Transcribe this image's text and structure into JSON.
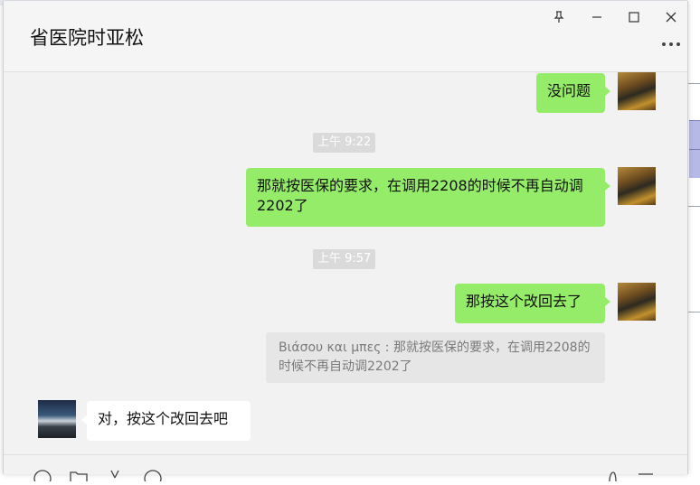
{
  "window": {
    "title": "省医院时亚松",
    "controls": {
      "pin_icon": "pin-icon",
      "minimize_icon": "minimize-icon",
      "maximize_icon": "maximize-icon",
      "close_icon": "close-icon",
      "more_icon": "more-icon"
    }
  },
  "messages": [
    {
      "side": "right",
      "text": "没问题"
    },
    {
      "type": "time",
      "text": "上午 9:22"
    },
    {
      "side": "right",
      "text": "那就按医保的要求，在调用2208的时候不再自动调2202了"
    },
    {
      "type": "time",
      "text": "上午 9:57"
    },
    {
      "side": "right",
      "text": "那按这个改回去了"
    },
    {
      "type": "quote",
      "text": "Βιάσου και μπες : 那就按医保的要求，在调用2208的时候不再自动调2202了"
    },
    {
      "side": "left",
      "text": "对，按这个改回去吧"
    }
  ],
  "toolbar": {
    "icons": [
      "emoji-icon",
      "folder-icon",
      "scissors-icon",
      "chat-history-icon",
      "phone-icon",
      "video-icon"
    ]
  },
  "colors": {
    "self_bubble": "#95ec69",
    "other_bubble": "#ffffff",
    "background": "#f2f2f2",
    "time_label_bg": "#dadada"
  }
}
